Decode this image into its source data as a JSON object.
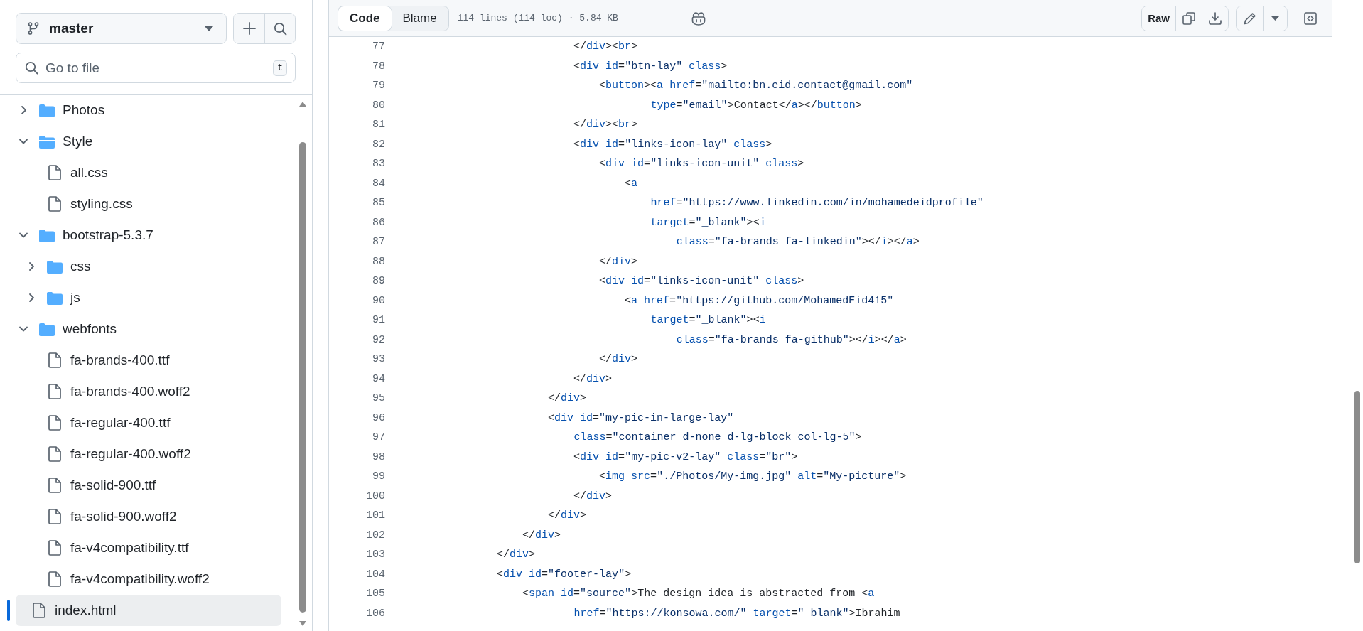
{
  "sidebar": {
    "branch": {
      "name": "master"
    },
    "go_to_file": {
      "placeholder": "Go to file",
      "shortcut": "t"
    },
    "tree": [
      {
        "kind": "folder",
        "label": "Photos",
        "expanded": false,
        "selected": false
      },
      {
        "kind": "folder",
        "label": "Style",
        "expanded": true,
        "selected": false,
        "children": [
          {
            "kind": "file",
            "label": "all.css",
            "selected": false
          },
          {
            "kind": "file",
            "label": "styling.css",
            "selected": false
          }
        ]
      },
      {
        "kind": "folder",
        "label": "bootstrap-5.3.7",
        "expanded": true,
        "selected": false,
        "children": [
          {
            "kind": "folder",
            "label": "css",
            "expanded": false,
            "selected": false
          },
          {
            "kind": "folder",
            "label": "js",
            "expanded": false,
            "selected": false
          }
        ]
      },
      {
        "kind": "folder",
        "label": "webfonts",
        "expanded": true,
        "selected": false,
        "children": [
          {
            "kind": "file",
            "label": "fa-brands-400.ttf",
            "selected": false
          },
          {
            "kind": "file",
            "label": "fa-brands-400.woff2",
            "selected": false
          },
          {
            "kind": "file",
            "label": "fa-regular-400.ttf",
            "selected": false
          },
          {
            "kind": "file",
            "label": "fa-regular-400.woff2",
            "selected": false
          },
          {
            "kind": "file",
            "label": "fa-solid-900.ttf",
            "selected": false
          },
          {
            "kind": "file",
            "label": "fa-solid-900.woff2",
            "selected": false
          },
          {
            "kind": "file",
            "label": "fa-v4compatibility.ttf",
            "selected": false
          },
          {
            "kind": "file",
            "label": "fa-v4compatibility.woff2",
            "selected": false
          }
        ]
      },
      {
        "kind": "file",
        "label": "index.html",
        "selected": true
      }
    ]
  },
  "file_header": {
    "tabs": [
      {
        "label": "Code",
        "selected": true
      },
      {
        "label": "Blame",
        "selected": false
      }
    ],
    "info": "114 lines (114 loc) · 5.84 KB",
    "raw_button": "Raw"
  },
  "code": {
    "lines": [
      {
        "number": "77",
        "text": "                        </div><br>"
      },
      {
        "number": "78",
        "text": "                        <div id=\"btn-lay\" class>"
      },
      {
        "number": "79",
        "text": "                            <button><a href=\"mailto:bn.eid.contact@gmail.com\""
      },
      {
        "number": "80",
        "text": "                                    type=\"email\">Contact</a></button>"
      },
      {
        "number": "81",
        "text": "                        </div><br>"
      },
      {
        "number": "82",
        "text": "                        <div id=\"links-icon-lay\" class>"
      },
      {
        "number": "83",
        "text": "                            <div id=\"links-icon-unit\" class>"
      },
      {
        "number": "84",
        "text": "                                <a"
      },
      {
        "number": "85",
        "text": "                                    href=\"https://www.linkedin.com/in/mohamedeidprofile\""
      },
      {
        "number": "86",
        "text": "                                    target=\"_blank\"><i"
      },
      {
        "number": "87",
        "text": "                                        class=\"fa-brands fa-linkedin\"></i></a>"
      },
      {
        "number": "88",
        "text": "                            </div>"
      },
      {
        "number": "89",
        "text": "                            <div id=\"links-icon-unit\" class>"
      },
      {
        "number": "90",
        "text": "                                <a href=\"https://github.com/MohamedEid415\""
      },
      {
        "number": "91",
        "text": "                                    target=\"_blank\"><i"
      },
      {
        "number": "92",
        "text": "                                        class=\"fa-brands fa-github\"></i></a>"
      },
      {
        "number": "93",
        "text": "                            </div>"
      },
      {
        "number": "94",
        "text": "                        </div>"
      },
      {
        "number": "95",
        "text": "                    </div>"
      },
      {
        "number": "96",
        "text": "                    <div id=\"my-pic-in-large-lay\""
      },
      {
        "number": "97",
        "text": "                        class=\"container d-none d-lg-block col-lg-5\">"
      },
      {
        "number": "98",
        "text": "                        <div id=\"my-pic-v2-lay\" class=\"br\">"
      },
      {
        "number": "99",
        "text": "                            <img src=\"./Photos/My-img.jpg\" alt=\"My-picture\">"
      },
      {
        "number": "100",
        "text": "                        </div>"
      },
      {
        "number": "101",
        "text": "                    </div>"
      },
      {
        "number": "102",
        "text": "                </div>"
      },
      {
        "number": "103",
        "text": "            </div>"
      },
      {
        "number": "104",
        "text": "            <div id=\"footer-lay\">"
      },
      {
        "number": "105",
        "text": "                <span id=\"source\">The design idea is abstracted from <a"
      },
      {
        "number": "106",
        "text": "                        href=\"https://konsowa.com/\" target=\"_blank\">Ibrahim"
      }
    ]
  }
}
